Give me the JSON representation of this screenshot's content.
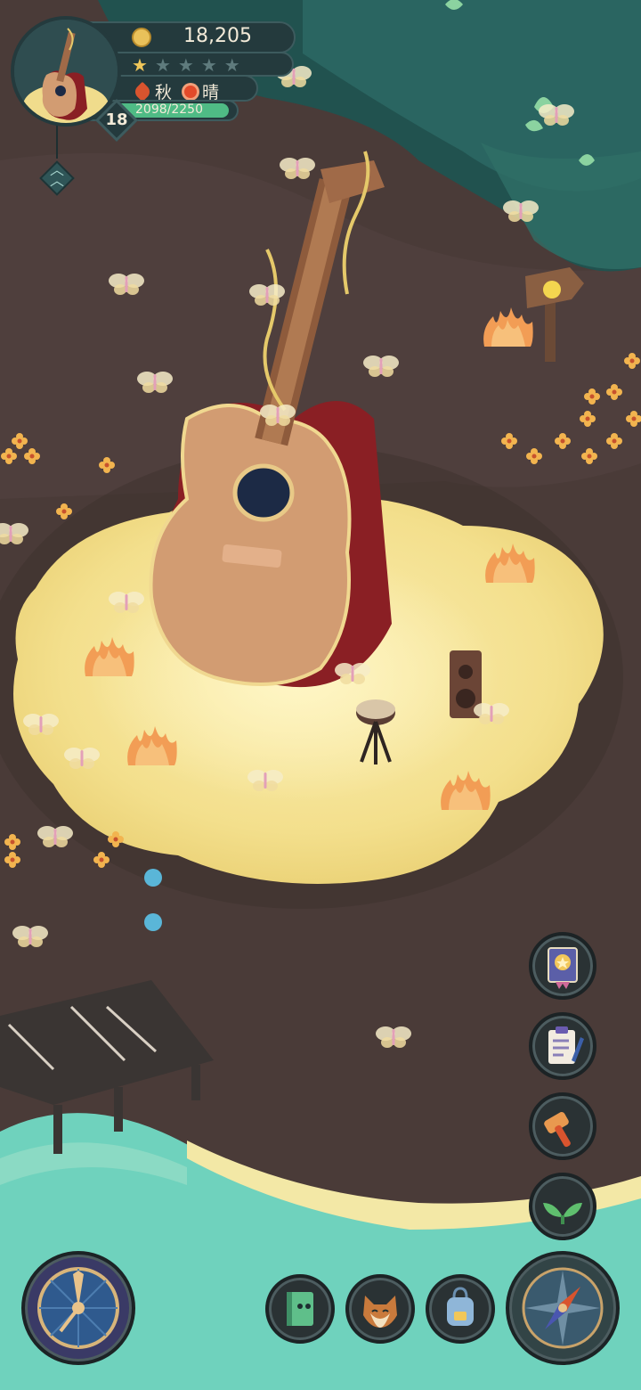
{
  "hud": {
    "coins": "18,205",
    "stars_filled": 1,
    "stars_total": 5,
    "season": "秋",
    "weather": "晴",
    "xp_text": "2098/2250",
    "xp_fraction": 0.932,
    "level": "18"
  },
  "icons": {
    "coin": "coin-icon",
    "star": "star-icon",
    "season": "maple-leaf-icon",
    "weather": "sun-icon",
    "expand": "double-chevron-up-icon",
    "side_buttons": [
      "achievement-badge-icon",
      "task-clipboard-icon",
      "hammer-icon",
      "sprout-icon"
    ],
    "bottom_buttons": [
      "clock-icon",
      "book-icon",
      "fox-icon",
      "backpack-icon",
      "compass-icon"
    ]
  },
  "colors": {
    "land": "#4a3b38",
    "sand": "#f6e49a",
    "sea": "#6fd2bd",
    "forest": "#21524f",
    "guitar_body": "#d29c72",
    "guitar_side": "#8a1f24",
    "hud_bg": "#243a3d",
    "xp": "#4fbb85"
  }
}
